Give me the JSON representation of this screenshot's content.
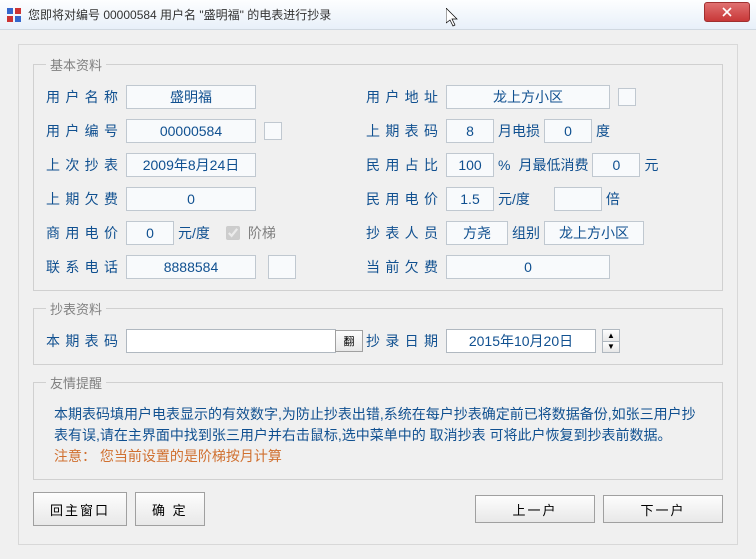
{
  "title": "您即将对编号 00000584 用户名 \"盛明福\" 的电表进行抄录",
  "groups": {
    "basic": "基本资料",
    "meter": "抄表资料",
    "tip": "友情提醒"
  },
  "labels": {
    "user_name": "用户名称",
    "user_addr": "用户地址",
    "user_no": "用户编号",
    "last_code": "上期表码",
    "month_loss": "月电损",
    "du": "度",
    "last_read": "上次抄表",
    "res_ratio": "民用占比",
    "pct": "%",
    "min_consume": "月最低消费",
    "yuan": "元",
    "last_owe": "上期欠费",
    "res_price": "民用电价",
    "yuan_du": "元/度",
    "bei": "倍",
    "biz_price": "商用电价",
    "tier": "阶梯",
    "reader": "抄表人员",
    "group": "组别",
    "phone": "联系电话",
    "cur_owe": "当前欠费",
    "cur_code": "本期表码",
    "read_date": "抄录日期",
    "flip": "翻"
  },
  "values": {
    "user_name": "盛明福",
    "user_addr": "龙上方小区",
    "user_no": "00000584",
    "last_code": "8",
    "month_loss": "0",
    "last_read": "2009年8月24日",
    "res_ratio": "100",
    "min_consume": "0",
    "last_owe": "0",
    "res_price": "1.5",
    "multiply": "",
    "biz_price": "0",
    "reader": "方尧",
    "group": "龙上方小区",
    "phone": "8888584",
    "cur_owe": "0",
    "cur_code": "",
    "read_date": "2015年10月20日"
  },
  "tip": {
    "line1": "本期表码填用户电表显示的有效数字,为防止抄表出错,系统在每户抄表确定前已将数据备份,如张三用户抄表有误,请在主界面中找到张三用户并右击鼠标,选中菜单中的 取消抄表 可将此户恢复到抄表前数据。",
    "note_label": "注意：",
    "note_text": "您当前设置的是阶梯按月计算"
  },
  "buttons": {
    "main": "回主窗口",
    "ok": "确  定",
    "prev": "上一户",
    "next": "下一户"
  }
}
